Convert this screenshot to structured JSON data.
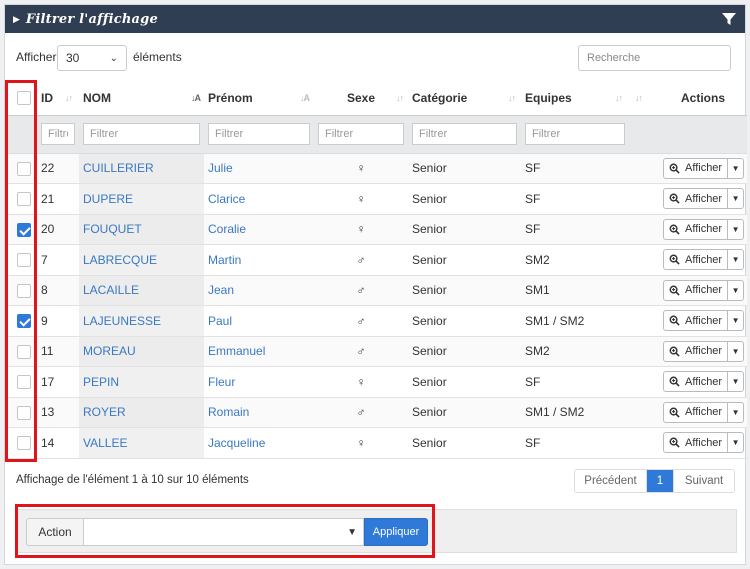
{
  "header": {
    "title": "Filtrer l'affichage",
    "filter_icon": "filter-icon"
  },
  "length": {
    "prefix": "Afficher",
    "value": "30",
    "suffix": "éléments"
  },
  "search": {
    "placeholder": "Recherche"
  },
  "columns": [
    "ID",
    "NOM",
    "Prénom",
    "Sexe",
    "Catégorie",
    "Equipes",
    "Actions"
  ],
  "filters": {
    "placeholder": "Filtrer",
    "id_placeholder": "Filtre"
  },
  "rows": [
    {
      "id": "22",
      "nom": "CUILLERIER",
      "prenom": "Julie",
      "sexe": "♀",
      "categorie": "Senior",
      "equipes": "SF",
      "checked": false
    },
    {
      "id": "21",
      "nom": "DUPERE",
      "prenom": "Clarice",
      "sexe": "♀",
      "categorie": "Senior",
      "equipes": "SF",
      "checked": false
    },
    {
      "id": "20",
      "nom": "FOUQUET",
      "prenom": "Coralie",
      "sexe": "♀",
      "categorie": "Senior",
      "equipes": "SF",
      "checked": true
    },
    {
      "id": "7",
      "nom": "LABRECQUE",
      "prenom": "Martin",
      "sexe": "♂",
      "categorie": "Senior",
      "equipes": "SM2",
      "checked": false
    },
    {
      "id": "8",
      "nom": "LACAILLE",
      "prenom": "Jean",
      "sexe": "♂",
      "categorie": "Senior",
      "equipes": "SM1",
      "checked": false
    },
    {
      "id": "9",
      "nom": "LAJEUNESSE",
      "prenom": "Paul",
      "sexe": "♂",
      "categorie": "Senior",
      "equipes": "SM1 / SM2",
      "checked": true
    },
    {
      "id": "11",
      "nom": "MOREAU",
      "prenom": "Emmanuel",
      "sexe": "♂",
      "categorie": "Senior",
      "equipes": "SM2",
      "checked": false
    },
    {
      "id": "17",
      "nom": "PEPIN",
      "prenom": "Fleur",
      "sexe": "♀",
      "categorie": "Senior",
      "equipes": "SF",
      "checked": false
    },
    {
      "id": "13",
      "nom": "ROYER",
      "prenom": "Romain",
      "sexe": "♂",
      "categorie": "Senior",
      "equipes": "SM1 / SM2",
      "checked": false
    },
    {
      "id": "14",
      "nom": "VALLEE",
      "prenom": "Jacqueline",
      "sexe": "♀",
      "categorie": "Senior",
      "equipes": "SF",
      "checked": false
    }
  ],
  "row_action_label": "Afficher",
  "info": "Affichage de l'élément 1 à 10 sur 10 éléments",
  "pagination": {
    "prev": "Précédent",
    "current": "1",
    "next": "Suivant"
  },
  "bulk": {
    "label": "Action",
    "selected": "",
    "apply": "Appliquer"
  },
  "colors": {
    "header_bg": "#2f3e52",
    "accent": "#2f7ad8",
    "link": "#3a78c3",
    "highlight": "#e0141b"
  }
}
